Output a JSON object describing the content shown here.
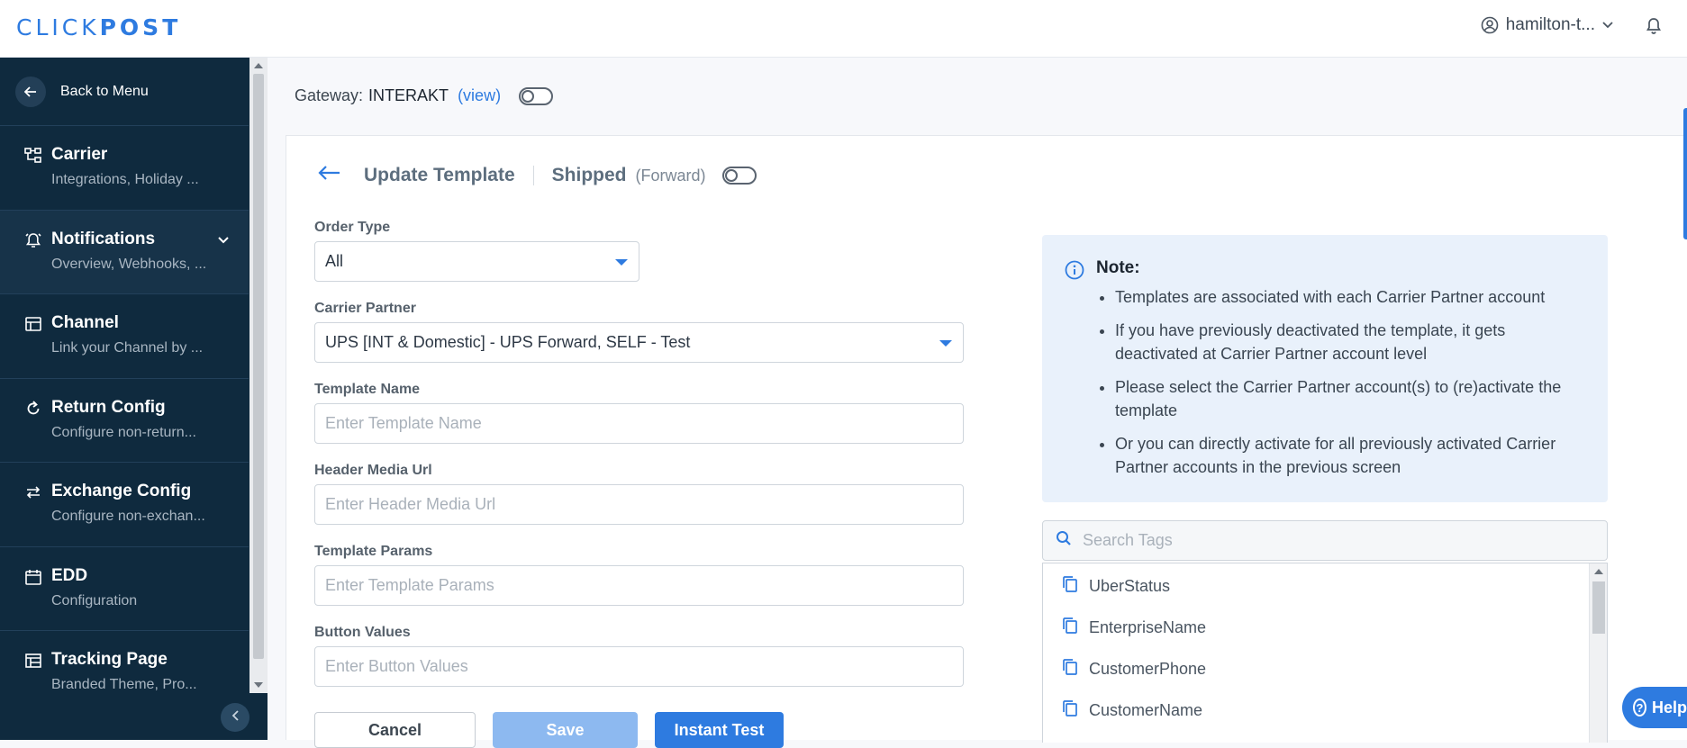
{
  "brand": {
    "part1": "CLICK",
    "part2": "POST"
  },
  "header": {
    "username": "hamilton-t..."
  },
  "sidebar": {
    "back_label": "Back to Menu",
    "items": [
      {
        "title": "Carrier",
        "subtitle": "Integrations, Holiday ..."
      },
      {
        "title": "Notifications",
        "subtitle": "Overview, Webhooks, ..."
      },
      {
        "title": "Channel",
        "subtitle": "Link your Channel by ..."
      },
      {
        "title": "Return Config",
        "subtitle": "Configure non-return..."
      },
      {
        "title": "Exchange Config",
        "subtitle": "Configure non-exchan..."
      },
      {
        "title": "EDD",
        "subtitle": "Configuration"
      },
      {
        "title": "Tracking Page",
        "subtitle": "Branded Theme, Pro..."
      }
    ]
  },
  "gateway": {
    "label": "Gateway:",
    "name": "INTERAKT",
    "view": "(view)"
  },
  "card": {
    "title": "Update Template",
    "status": "Shipped",
    "direction": "(Forward)"
  },
  "form": {
    "order_type": {
      "label": "Order Type",
      "value": "All"
    },
    "carrier_partner": {
      "label": "Carrier Partner",
      "value": "UPS [INT & Domestic] - UPS Forward, SELF - Test"
    },
    "template_name": {
      "label": "Template Name",
      "placeholder": "Enter Template Name"
    },
    "header_media_url": {
      "label": "Header Media Url",
      "placeholder": "Enter Header Media Url"
    },
    "template_params": {
      "label": "Template Params",
      "placeholder": "Enter Template Params"
    },
    "button_values": {
      "label": "Button Values",
      "placeholder": "Enter Button Values"
    }
  },
  "buttons": {
    "cancel": "Cancel",
    "save": "Save",
    "instant_test": "Instant Test"
  },
  "note": {
    "title": "Note:",
    "points": [
      "Templates are associated with each Carrier Partner account",
      "If you have previously deactivated the template, it gets deactivated at Carrier Partner account level",
      "Please select the Carrier Partner account(s) to (re)activate the template",
      "Or you can directly activate for all previously activated Carrier Partner accounts in the previous screen"
    ]
  },
  "tags": {
    "search_placeholder": "Search Tags",
    "items": [
      "UberStatus",
      "EnterpriseName",
      "CustomerPhone",
      "CustomerName"
    ]
  },
  "help": {
    "label": "Help"
  },
  "colors": {
    "accent": "#2e7be0",
    "sidebar": "#0f2a3e",
    "note_bg": "#e9f1fb"
  }
}
